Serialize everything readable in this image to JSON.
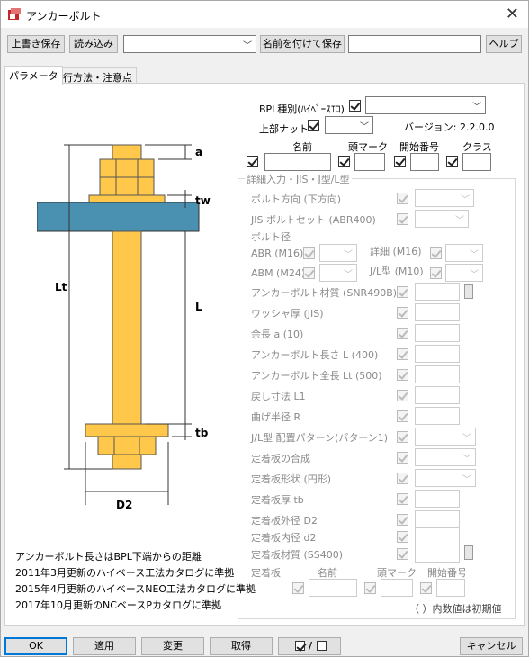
{
  "window": {
    "title": "アンカーボルト"
  },
  "toolbar": {
    "overwrite_save": "上書き保存",
    "load": "読み込み",
    "save_as": "名前を付けて保存",
    "help": "ヘルプ"
  },
  "tabs": [
    "パラメータ",
    "実行方法・注意点"
  ],
  "top": {
    "bpl_type_label": "BPL種別(ﾊｲﾍﾞｰｽｴｺ)",
    "upper_nut_label": "上部ナット",
    "version": "バージョン: 2.2.0.0",
    "name_header": "名前",
    "head_mark_header": "頭マーク",
    "start_no_header": "開始番号",
    "class_header": "クラス"
  },
  "detail": {
    "group_title": "詳細入力・JIS・J型/L型",
    "rows": [
      "ボルト方向 (下方向)",
      "JIS ボルトセット (ABR400)",
      "ボルト径",
      "ABR (M16)",
      "詳細 (M16)",
      "ABM (M24)",
      "J/L型 (M10)",
      "アンカーボルト材質 (SNR490B)",
      "ワッシャ厚 (JIS)",
      "余長 a (10)",
      "アンカーボルト長さ L (400)",
      "アンカーボルト全長 Lt (500)",
      "戻し寸法 L1",
      "曲げ半径 R",
      "J/L型 配置パターン(パターン1)",
      "定着板の合成",
      "定着板形状 (円形)",
      "定着板厚 tb",
      "定着板外径 D2",
      "定着板内径 d2",
      "定着板材質 (SS400)"
    ],
    "bottom_label": "定着板",
    "bottom_name": "名前",
    "bottom_head_mark": "頭マーク",
    "bottom_start_no": "開始番号",
    "footnote": "（ ）内数値は初期値",
    "mini_btn": "..."
  },
  "diagram": {
    "label_a": "a",
    "label_tw": "tw",
    "label_Lt": "Lt",
    "label_L": "L",
    "label_tb": "tb",
    "label_D2": "D2",
    "bolt_color": "#ffc84a",
    "plate_color": "#4a90b0"
  },
  "notes": [
    "アンカーボルト長さはBPL下端からの距離",
    "2011年3月更新のハイベース工法カタログに準拠",
    "2015年4月更新のハイベースNEO工法カタログに準拠",
    "2017年10月更新のNCベースPカタログに準拠"
  ],
  "bottom": {
    "ok": "OK",
    "apply": "適用",
    "modify": "変更",
    "get": "取得",
    "toggle": "/",
    "cancel": "キャンセル"
  }
}
